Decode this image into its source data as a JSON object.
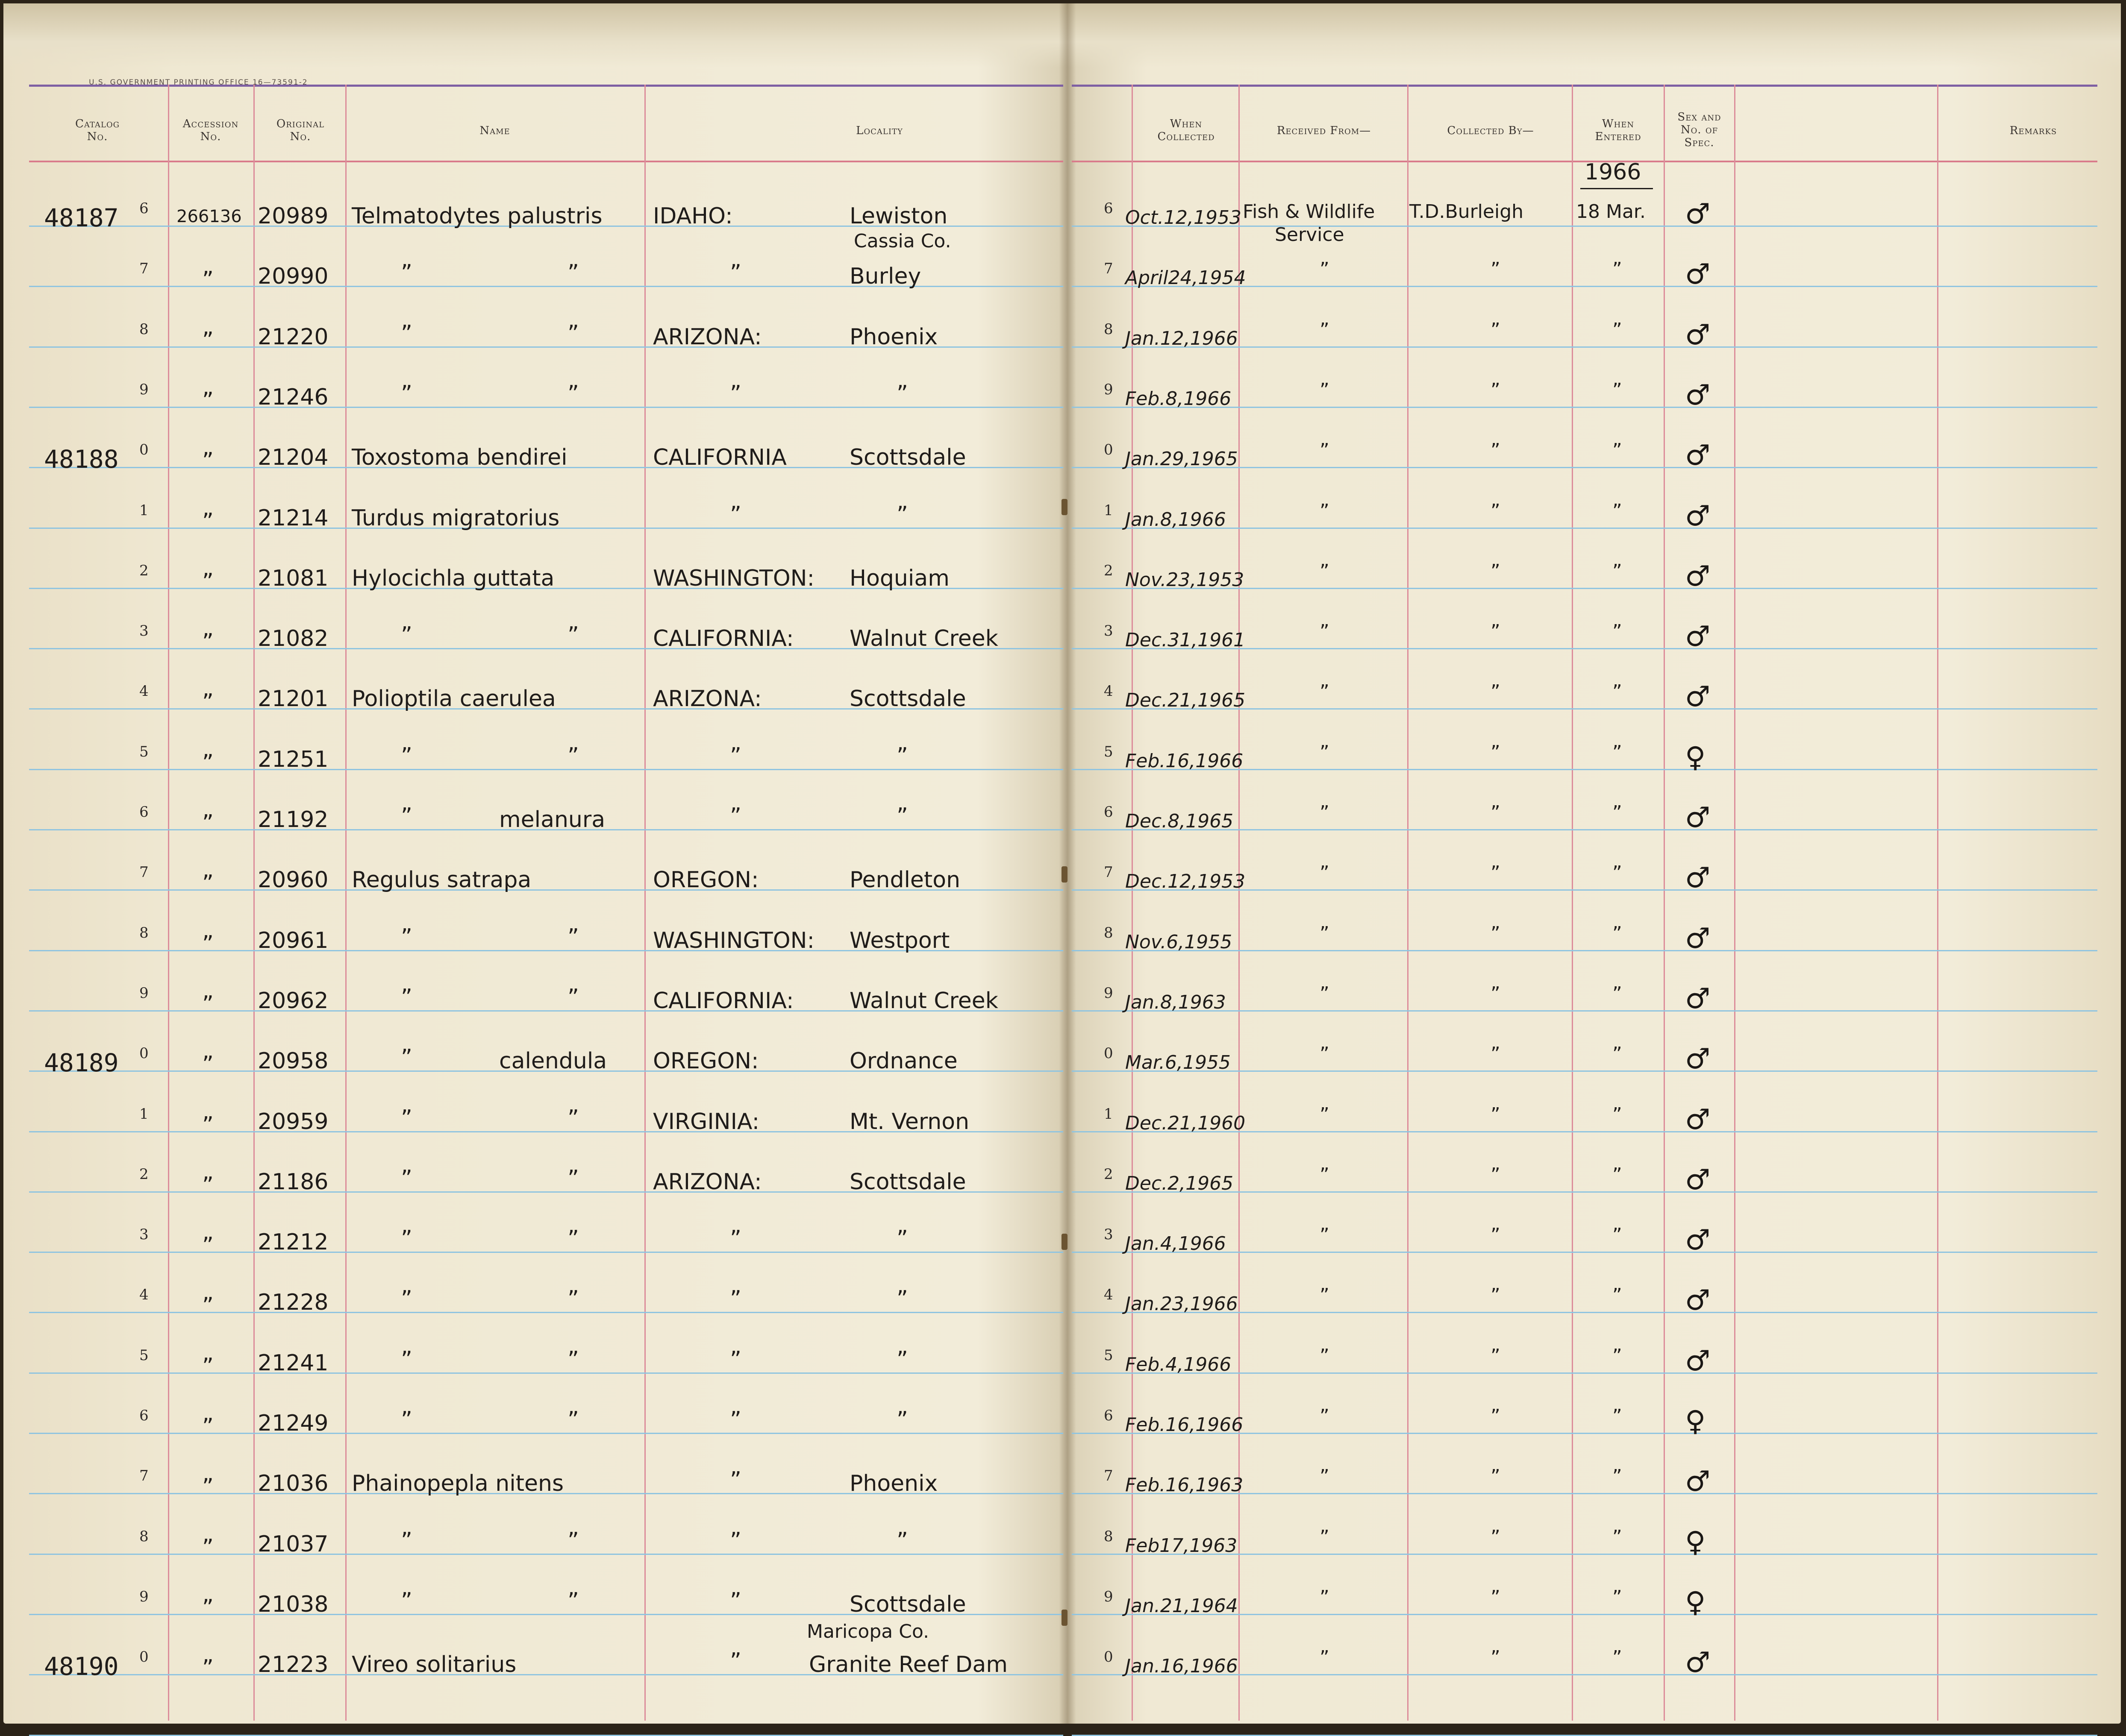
{
  "printer_mark": "U.S. GOVERNMENT PRINTING OFFICE   16—73591-2",
  "headers": {
    "catalog_no": [
      "Catalog",
      "No."
    ],
    "accession_no": [
      "Accession",
      "No."
    ],
    "original_no": [
      "Original",
      "No."
    ],
    "name": "Name",
    "locality": "Locality",
    "when_collected": [
      "When",
      "Collected"
    ],
    "received_from": "Received From—",
    "collected_by": "Collected By—",
    "when_entered": [
      "When",
      "Entered"
    ],
    "sex_spec": [
      "Sex and",
      "No. of",
      "Spec."
    ],
    "remarks": "Remarks"
  },
  "entered_year": "1966",
  "rows": [
    {
      "catalog": "481876",
      "digit": "6",
      "accession": "266136",
      "original": "20989",
      "name": "Telmatodytes palustris",
      "state": "IDAHO:",
      "place": "Lewiston",
      "right_digit": "6",
      "collected": "Oct.12,1953",
      "received": "Fish & Wildlife",
      "received2": "Service",
      "collector": "T.D.Burleigh",
      "entered": "18 Mar.",
      "sex": "♂"
    },
    {
      "catalog": "",
      "digit": "7",
      "accession": "”",
      "original": "20990",
      "name_a": "”",
      "name_b": "”",
      "county": "Cassia Co.",
      "state": "”",
      "place": "Burley",
      "right_digit": "7",
      "collected": "April24,1954",
      "received": "”",
      "collector": "”",
      "entered": "”",
      "sex": "♂"
    },
    {
      "catalog": "",
      "digit": "8",
      "accession": "”",
      "original": "21220",
      "name_a": "”",
      "name_b": "”",
      "state": "ARIZONA:",
      "place": "Phoenix",
      "right_digit": "8",
      "collected": "Jan.12,1966",
      "received": "”",
      "collector": "”",
      "entered": "”",
      "sex": "♂"
    },
    {
      "catalog": "",
      "digit": "9",
      "accession": "”",
      "original": "21246",
      "name_a": "”",
      "name_b": "”",
      "state": "”",
      "place": "”",
      "right_digit": "9",
      "collected": "Feb.8,1966",
      "received": "”",
      "collector": "”",
      "entered": "”",
      "sex": "♂"
    },
    {
      "catalog": "48188",
      "digit": "0",
      "accession": "”",
      "original": "21204",
      "name": "Toxostoma bendirei",
      "state": "CALIFORNIA",
      "place": "Scottsdale",
      "right_digit": "0",
      "collected": "Jan.29,1965",
      "received": "”",
      "collector": "”",
      "entered": "”",
      "sex": "♂"
    },
    {
      "catalog": "",
      "digit": "1",
      "accession": "”",
      "original": "21214",
      "name": "Turdus migratorius",
      "state": "”",
      "place": "”",
      "right_digit": "1",
      "collected": "Jan.8,1966",
      "received": "”",
      "collector": "”",
      "entered": "”",
      "sex": "♂"
    },
    {
      "catalog": "",
      "digit": "2",
      "accession": "”",
      "original": "21081",
      "name": "Hylocichla guttata",
      "state": "WASHINGTON:",
      "place": "Hoquiam",
      "right_digit": "2",
      "collected": "Nov.23,1953",
      "received": "”",
      "collector": "”",
      "entered": "”",
      "sex": "♂"
    },
    {
      "catalog": "",
      "digit": "3",
      "accession": "”",
      "original": "21082",
      "name_a": "”",
      "name_b": "”",
      "state": "CALIFORNIA:",
      "place": "Walnut Creek",
      "right_digit": "3",
      "collected": "Dec.31,1961",
      "received": "”",
      "collector": "”",
      "entered": "”",
      "sex": "♂"
    },
    {
      "catalog": "",
      "digit": "4",
      "accession": "”",
      "original": "21201",
      "name": "Polioptila caerulea",
      "state": "ARIZONA:",
      "place": "Scottsdale",
      "right_digit": "4",
      "collected": "Dec.21,1965",
      "received": "”",
      "collector": "”",
      "entered": "”",
      "sex": "♂"
    },
    {
      "catalog": "",
      "digit": "5",
      "accession": "”",
      "original": "21251",
      "name_a": "”",
      "name_b": "”",
      "state": "”",
      "place": "”",
      "right_digit": "5",
      "collected": "Feb.16,1966",
      "received": "”",
      "collector": "”",
      "entered": "”",
      "sex": "♀"
    },
    {
      "catalog": "",
      "digit": "6",
      "accession": "”",
      "original": "21192",
      "name_a": "”",
      "name_b": "melanura",
      "state": "”",
      "place": "”",
      "right_digit": "6",
      "collected": "Dec.8,1965",
      "received": "”",
      "collector": "”",
      "entered": "”",
      "sex": "♂"
    },
    {
      "catalog": "",
      "digit": "7",
      "accession": "”",
      "original": "20960",
      "name": "Regulus satrapa",
      "state": "OREGON:",
      "place": "Pendleton",
      "right_digit": "7",
      "collected": "Dec.12,1953",
      "received": "”",
      "collector": "”",
      "entered": "”",
      "sex": "♂"
    },
    {
      "catalog": "",
      "digit": "8",
      "accession": "”",
      "original": "20961",
      "name_a": "”",
      "name_b": "”",
      "state": "WASHINGTON:",
      "place": "Westport",
      "right_digit": "8",
      "collected": "Nov.6,1955",
      "received": "”",
      "collector": "”",
      "entered": "”",
      "sex": "♂"
    },
    {
      "catalog": "",
      "digit": "9",
      "accession": "”",
      "original": "20962",
      "name_a": "”",
      "name_b": "”",
      "state": "CALIFORNIA:",
      "place": "Walnut Creek",
      "right_digit": "9",
      "collected": "Jan.8,1963",
      "received": "”",
      "collector": "”",
      "entered": "”",
      "sex": "♂"
    },
    {
      "catalog": "48189",
      "digit": "0",
      "accession": "”",
      "original": "20958",
      "name_a": "”",
      "name_b": "calendula",
      "state": "OREGON:",
      "place": "Ordnance",
      "right_digit": "0",
      "collected": "Mar.6,1955",
      "received": "”",
      "collector": "”",
      "entered": "”",
      "sex": "♂"
    },
    {
      "catalog": "",
      "digit": "1",
      "accession": "”",
      "original": "20959",
      "name_a": "”",
      "name_b": "”",
      "state": "VIRGINIA:",
      "place": "Mt. Vernon",
      "right_digit": "1",
      "collected": "Dec.21,1960",
      "received": "”",
      "collector": "”",
      "entered": "”",
      "sex": "♂"
    },
    {
      "catalog": "",
      "digit": "2",
      "accession": "”",
      "original": "21186",
      "name_a": "”",
      "name_b": "”",
      "state": "ARIZONA:",
      "place": "Scottsdale",
      "right_digit": "2",
      "collected": "Dec.2,1965",
      "received": "”",
      "collector": "”",
      "entered": "”",
      "sex": "♂"
    },
    {
      "catalog": "",
      "digit": "3",
      "accession": "”",
      "original": "21212",
      "name_a": "”",
      "name_b": "”",
      "state": "”",
      "place": "”",
      "right_digit": "3",
      "collected": "Jan.4,1966",
      "received": "”",
      "collector": "”",
      "entered": "”",
      "sex": "♂"
    },
    {
      "catalog": "",
      "digit": "4",
      "accession": "”",
      "original": "21228",
      "name_a": "”",
      "name_b": "”",
      "state": "”",
      "place": "”",
      "right_digit": "4",
      "collected": "Jan.23,1966",
      "received": "”",
      "collector": "”",
      "entered": "”",
      "sex": "♂"
    },
    {
      "catalog": "",
      "digit": "5",
      "accession": "”",
      "original": "21241",
      "name_a": "”",
      "name_b": "”",
      "state": "”",
      "place": "”",
      "right_digit": "5",
      "collected": "Feb.4,1966",
      "received": "”",
      "collector": "”",
      "entered": "”",
      "sex": "♂"
    },
    {
      "catalog": "",
      "digit": "6",
      "accession": "”",
      "original": "21249",
      "name_a": "”",
      "name_b": "”",
      "state": "”",
      "place": "”",
      "right_digit": "6",
      "collected": "Feb.16,1966",
      "received": "”",
      "collector": "”",
      "entered": "”",
      "sex": "♀"
    },
    {
      "catalog": "",
      "digit": "7",
      "accession": "”",
      "original": "21036",
      "name": "Phainopepla nitens",
      "state": "”",
      "place": "Phoenix",
      "right_digit": "7",
      "collected": "Feb.16,1963",
      "received": "”",
      "collector": "”",
      "entered": "”",
      "sex": "♂"
    },
    {
      "catalog": "",
      "digit": "8",
      "accession": "”",
      "original": "21037",
      "name_a": "”",
      "name_b": "”",
      "state": "”",
      "place": "”",
      "right_digit": "8",
      "collected": "Feb17,1963",
      "received": "”",
      "collector": "”",
      "entered": "”",
      "sex": "♀"
    },
    {
      "catalog": "",
      "digit": "9",
      "accession": "”",
      "original": "21038",
      "name_a": "”",
      "name_b": "”",
      "state": "”",
      "place": "Scottsdale",
      "county_next": "Maricopa Co.",
      "right_digit": "9",
      "collected": "Jan.21,1964",
      "received": "”",
      "collector": "”",
      "entered": "”",
      "sex": "♀"
    },
    {
      "catalog": "48190",
      "digit": "0",
      "accession": "”",
      "original": "21223",
      "name": "Vireo solitarius",
      "state": "”",
      "place": "Granite Reef Dam",
      "right_digit": "0",
      "collected": "Jan.16,1966",
      "received": "”",
      "collector": "”",
      "entered": "”",
      "sex": "♂"
    }
  ]
}
